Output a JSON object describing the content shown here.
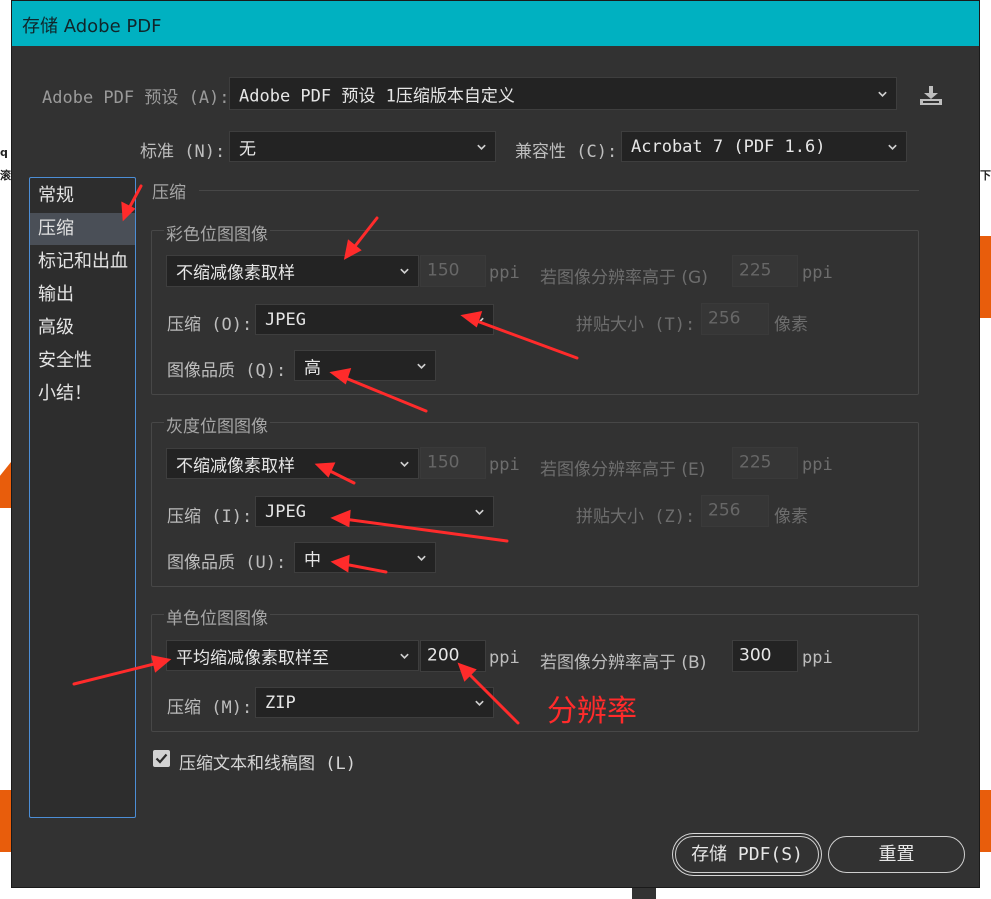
{
  "dialog": {
    "title": "存储 Adobe PDF",
    "preset_label": "Adobe PDF 预设 (A):",
    "preset_value": "Adobe PDF 预设 1压缩版本自定义",
    "standard_label": "标准 (N):",
    "standard_value": "无",
    "compat_label": "兼容性 (C):",
    "compat_value": "Acrobat 7 (PDF 1.6)"
  },
  "sidebar": {
    "items": [
      {
        "label": "常规"
      },
      {
        "label": "压缩"
      },
      {
        "label": "标记和出血"
      },
      {
        "label": "输出"
      },
      {
        "label": "高级"
      },
      {
        "label": "安全性"
      },
      {
        "label": "小结！"
      }
    ],
    "active_index": 1
  },
  "section_title": "压缩",
  "color_bitmap": {
    "title": "彩色位图图像",
    "sampling": "不缩减像素取样",
    "ppi": "150",
    "ppi_unit": "ppi",
    "threshold_label": "若图像分辨率高于 (G)",
    "threshold": "225",
    "threshold_unit": "ppi",
    "compression_label": "压缩 (O):",
    "compression": "JPEG",
    "tile_label": "拼贴大小 (T):",
    "tile": "256",
    "tile_unit": "像素",
    "quality_label": "图像品质 (Q):",
    "quality": "高"
  },
  "gray_bitmap": {
    "title": "灰度位图图像",
    "sampling": "不缩减像素取样",
    "ppi": "150",
    "ppi_unit": "ppi",
    "threshold_label": "若图像分辨率高于 (E)",
    "threshold": "225",
    "threshold_unit": "ppi",
    "compression_label": "压缩 (I):",
    "compression": "JPEG",
    "tile_label": "拼贴大小 (Z):",
    "tile": "256",
    "tile_unit": "像素",
    "quality_label": "图像品质 (U):",
    "quality": "中"
  },
  "mono_bitmap": {
    "title": "单色位图图像",
    "sampling": "平均缩减像素取样至",
    "ppi": "200",
    "ppi_unit": "ppi",
    "threshold_label": "若图像分辨率高于 (B)",
    "threshold": "300",
    "threshold_unit": "ppi",
    "compression_label": "压缩 (M):",
    "compression": "ZIP"
  },
  "compress_text": {
    "label": "压缩文本和线稿图 (L)",
    "checked": true
  },
  "buttons": {
    "save": "存储 PDF(S)",
    "reset": "重置"
  },
  "annotation": "分辨率",
  "background_fragments": {
    "left_top": "q",
    "left_mid": "滚",
    "right_mid": "下"
  },
  "colors": {
    "titlebar": "#00b1c1",
    "dialog_bg": "#323232",
    "accent_border": "#4c8ed6",
    "annotation_red": "#ff2b2b",
    "background_orange": "#e85d0c"
  }
}
